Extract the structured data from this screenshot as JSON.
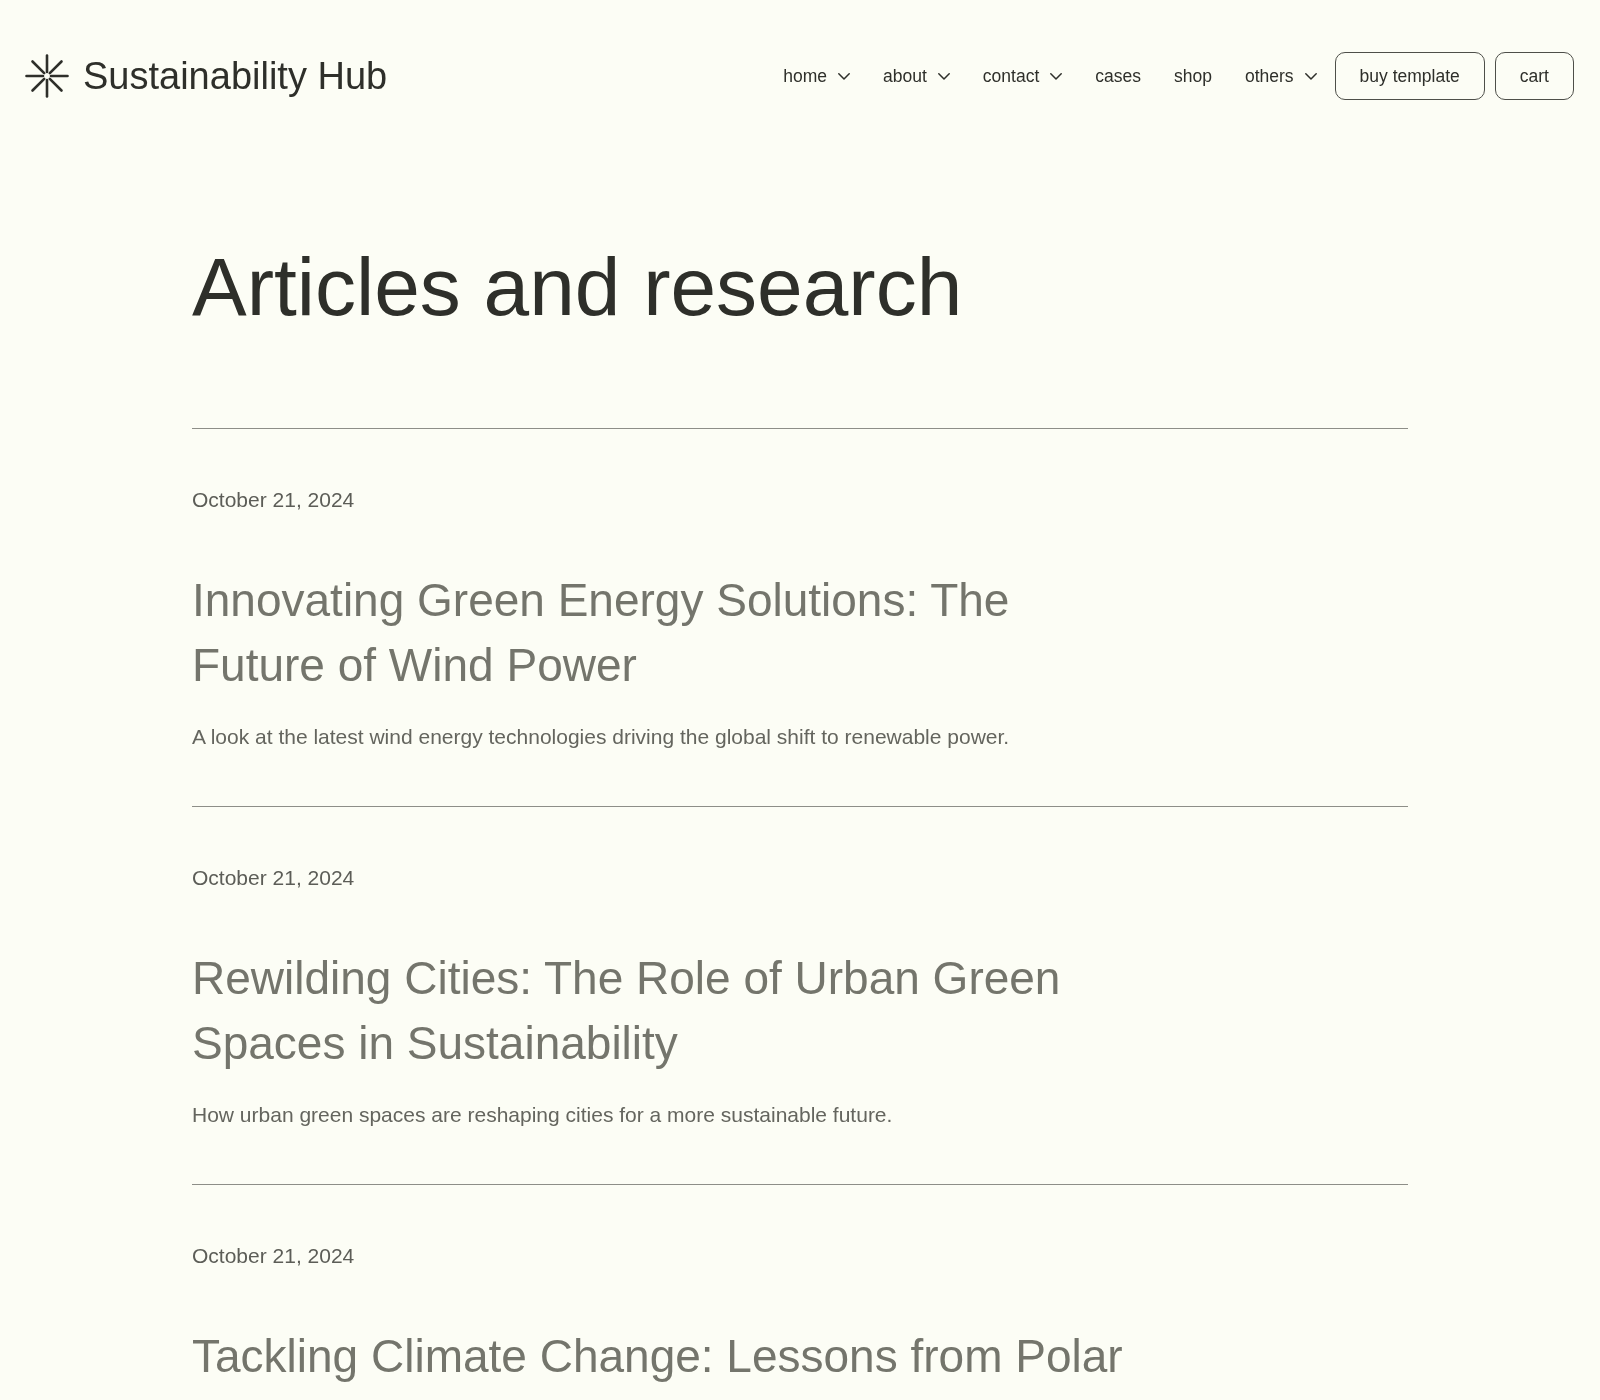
{
  "header": {
    "logo": "Sustainability Hub",
    "nav": [
      {
        "label": "home",
        "kind": "dropdown"
      },
      {
        "label": "about",
        "kind": "dropdown"
      },
      {
        "label": "contact",
        "kind": "dropdown"
      },
      {
        "label": "cases",
        "kind": "link"
      },
      {
        "label": "shop",
        "kind": "link"
      },
      {
        "label": "others",
        "kind": "dropdown"
      }
    ],
    "buttons": [
      "buy template",
      "cart"
    ]
  },
  "page_title": "Articles and research",
  "articles": [
    {
      "date": "October 21, 2024",
      "title": "Innovating Green Energy Solutions: The Future of Wind Power",
      "summary": "A look at the latest wind energy technologies driving the global shift to renewable power."
    },
    {
      "date": "October 21, 2024",
      "title": "Rewilding Cities: The Role of Urban Green Spaces in Sustainability",
      "summary": "How urban green spaces are reshaping cities for a more sustainable future."
    },
    {
      "date": "October 21, 2024",
      "title": "Tackling Climate Change: Lessons from Polar"
    }
  ]
}
